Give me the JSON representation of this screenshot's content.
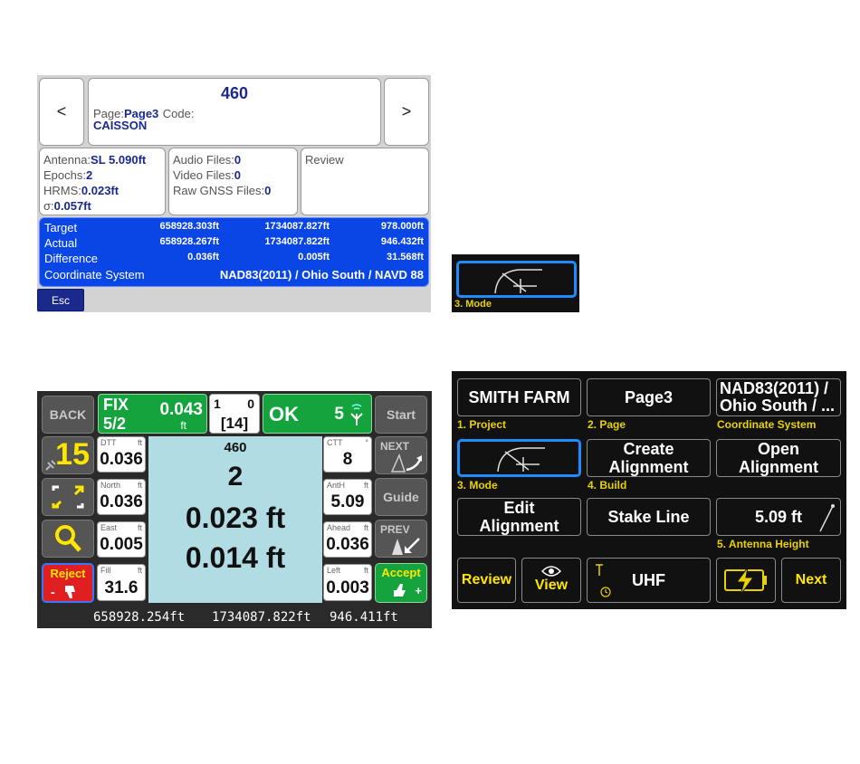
{
  "store_panel": {
    "prev": "<",
    "next": ">",
    "point_name": "460",
    "page_label": "Page:",
    "page_value": "Page3",
    "code_label": "Code:",
    "code_value": "CAISSON",
    "antenna_label": "Antenna:",
    "antenna_value": "SL 5.090ft",
    "epochs_label": "Epochs:",
    "epochs_value": "2",
    "hrms_label": "HRMS:",
    "hrms_value": "0.023ft",
    "sigma_label": "σ:",
    "sigma_value": "0.057ft",
    "audio_label": "Audio Files:",
    "audio_value": "0",
    "video_label": "Video Files:",
    "video_value": "0",
    "raw_label": "Raw GNSS Files:",
    "raw_value": "0",
    "review": "Review",
    "rows": [
      {
        "label": "Target",
        "a": "658928.303ft",
        "b": "1734087.827ft",
        "c": "978.000ft"
      },
      {
        "label": "Actual",
        "a": "658928.267ft",
        "b": "1734087.822ft",
        "c": "946.432ft"
      },
      {
        "label": "Difference",
        "a": "0.036ft",
        "b": "0.005ft",
        "c": "31.568ft"
      }
    ],
    "cs_label": "Coordinate System",
    "cs_value": "NAD83(2011) / Ohio South / NAVD 88",
    "esc": "Esc"
  },
  "mode_panel": {
    "label": "3. Mode"
  },
  "stake_panel": {
    "back": "BACK",
    "fix": "FIX",
    "fix_ratio": "5/2",
    "fix_value": "0.043",
    "fix_unit": "ft",
    "sats_a": "1",
    "sats_b": "0",
    "sats_c": "[14]",
    "ok": "OK",
    "ok_count": "5",
    "start": "Start",
    "sat_count": "15",
    "dtt_label": "DTT",
    "dtt_unit": "ft",
    "dtt_value": "0.036",
    "north_label": "North",
    "north_unit": "ft",
    "north_value": "0.036",
    "east_label": "East",
    "east_unit": "ft",
    "east_value": "0.005",
    "fill_label": "Fill",
    "fill_unit": "ft",
    "fill_value": "31.6",
    "reject": "Reject",
    "point_name": "460",
    "center_num": "2",
    "hz": "0.023 ft",
    "vt": "0.014 ft",
    "ctt_label": "CTT",
    "ctt_unit": "°",
    "ctt_value": "8",
    "anth_label": "AntH",
    "anth_unit": "ft",
    "anth_value": "5.09",
    "ahead_label": "Ahead",
    "ahead_unit": "ft",
    "ahead_value": "0.036",
    "left_label": "Left",
    "left_unit": "ft",
    "left_value": "0.003",
    "next": "NEXT",
    "guide": "Guide",
    "prev": "PREV",
    "accept": "Accept",
    "coord_n": "658928.254ft",
    "coord_e": "1734087.822ft",
    "coord_z": "946.411ft"
  },
  "menu_panel": {
    "project": "SMITH FARM",
    "project_label": "1. Project",
    "page": "Page3",
    "page_label": "2. Page",
    "cs": "NAD83(2011) / Ohio South / ...",
    "cs_label": "Coordinate System",
    "mode_label": "3. Mode",
    "create": "Create Alignment",
    "build_label": "4. Build",
    "open": "Open Alignment",
    "edit": "Edit Alignment",
    "stake_line": "Stake Line",
    "antenna": "5.09 ft",
    "antenna_label": "5. Antenna Height",
    "review": "Review",
    "view": "View",
    "radio": "UHF",
    "next": "Next"
  },
  "colors": {
    "blue": "#0a46e6",
    "green": "#14a33c",
    "yellow": "#e8d200",
    "red": "#e02020",
    "navy": "#1a2a8c"
  }
}
